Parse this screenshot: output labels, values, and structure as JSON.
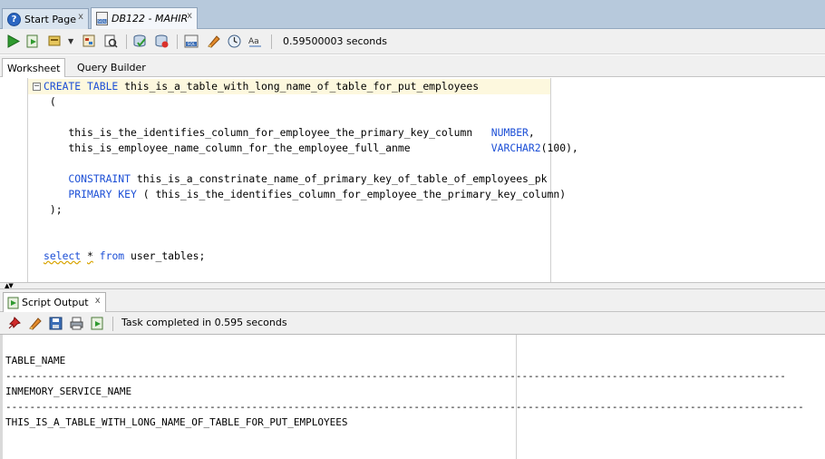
{
  "tabs": [
    {
      "label": "Start Page",
      "close": "x"
    },
    {
      "label": "DB122 - MAHIR",
      "close": "x"
    }
  ],
  "toolbar": {
    "exec_time": "0.59500003 seconds"
  },
  "subtabs": {
    "worksheet": "Worksheet",
    "query_builder": "Query Builder"
  },
  "editor": {
    "lines": {
      "l1_kw": "CREATE TABLE",
      "l1_name": " this_is_a_table_with_long_name_of_table_for_put_employees",
      "l2": " (",
      "l3_col": "    this_is_the_identifies_column_for_employee_the_primary_key_column   ",
      "l3_type": "NUMBER",
      "l3_end": ",",
      "l4_col": "    this_is_employee_name_column_for_the_employee_full_anme             ",
      "l4_type": "VARCHAR2",
      "l4_end": "(100),",
      "l5_kw": "    CONSTRAINT",
      "l5_name": " this_is_a_constrinate_name_of_primary_key_of_table_of_employees_pk",
      "l6_kw": "    PRIMARY KEY",
      "l6_rest": " ( this_is_the_identifies_column_for_employee_the_primary_key_column)",
      "l7": " );",
      "l8_kw1": "select",
      "l8_sp1": " ",
      "l8_star": "*",
      "l8_sp2": " ",
      "l8_kw2": "from",
      "l8_rest": " user_tables;"
    }
  },
  "output": {
    "tab_label": "Script Output",
    "tab_close": "x",
    "status": "Task completed in 0.595 seconds",
    "lines": [
      "TABLE_NAME",
      "----------------------------------------------------------------------------------------------------------------------------------",
      "INMEMORY_SERVICE_NAME",
      "-------------------------------------------------------------------------------------------------------------------------------------",
      "THIS_IS_A_TABLE_WITH_LONG_NAME_OF_TABLE_FOR_PUT_EMPLOYEES"
    ]
  },
  "colors": {
    "keyword": "#1c4fd6",
    "current_line": "#fdf8de",
    "tab_bar": "#b7c9dc"
  },
  "icons": [
    "help-icon",
    "sql-worksheet-icon",
    "run-statement-icon",
    "run-script-icon",
    "commit-icon",
    "rollback-icon",
    "autotrace-icon",
    "explain-plan-icon",
    "sql-tuning-icon",
    "clear-icon",
    "history-icon",
    "case-icon",
    "pin-icon",
    "eraser-icon",
    "save-icon",
    "print-icon",
    "run-output-icon"
  ]
}
